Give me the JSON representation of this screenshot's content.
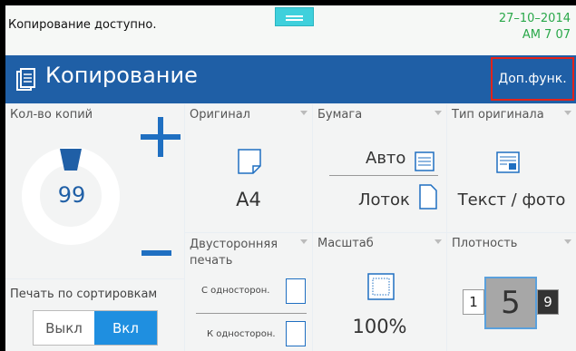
{
  "status": {
    "message": "Копирование доступно.",
    "date": "27–10–2014",
    "time": "AM 7 07"
  },
  "header": {
    "title": "Копирование",
    "more_functions": "Доп.функ."
  },
  "copies": {
    "label": "Кол-во копий",
    "value": "99"
  },
  "original": {
    "label": "Оригинал",
    "size": "A4"
  },
  "paper": {
    "label": "Бумага",
    "auto": "Авто",
    "tray": "Лоток"
  },
  "original_type": {
    "label": "Тип оригинала",
    "value": "Текст / фото"
  },
  "duplex": {
    "label": "Двусторонняя печать",
    "from": "С односторон.",
    "to": "К односторон."
  },
  "scale": {
    "label": "Масштаб",
    "value": "100%"
  },
  "density": {
    "label": "Плотность",
    "min": "1",
    "current": "5",
    "max": "9"
  },
  "sort": {
    "label": "Печать по сортировкам",
    "off": "Выкл",
    "on": "Вкл",
    "selected": "on"
  },
  "colors": {
    "header": "#1f5fa6",
    "accent": "#1f6fc1",
    "status_green": "#2aa84a",
    "highlight_red": "#e2231a",
    "toggle_on": "#1f8fe0"
  }
}
